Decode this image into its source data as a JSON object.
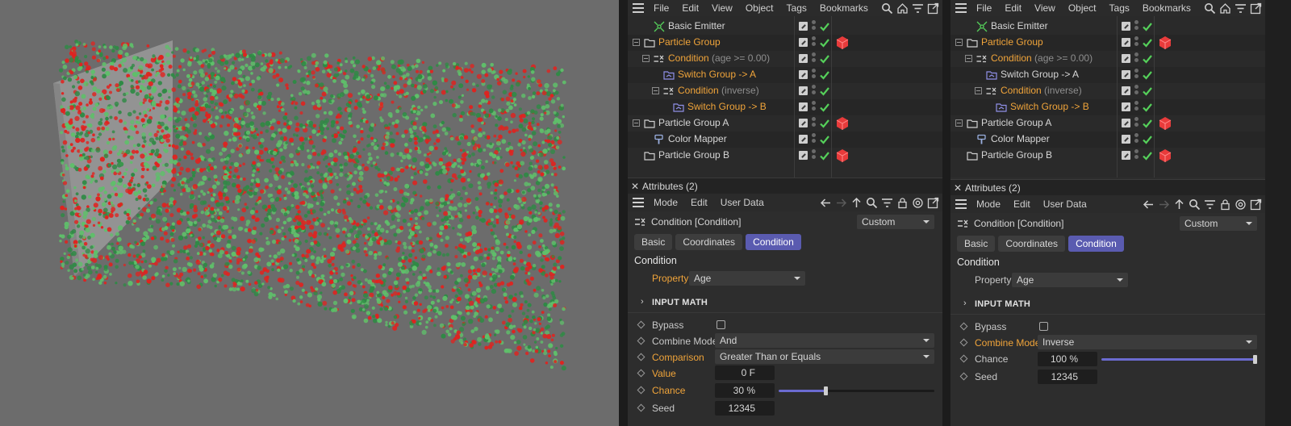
{
  "menu": {
    "items": [
      "File",
      "Edit",
      "View",
      "Object",
      "Tags",
      "Bookmarks"
    ]
  },
  "colors": {
    "accent_tab": "#5a5bb0",
    "orange": "#f0a43a",
    "check": "#55d05a",
    "cube": "#e83b3b",
    "slider": "#6b6bd0"
  },
  "viewport": {
    "particles_red": "#e0231f",
    "particles_green_light": "#5fbf6a",
    "particles_green_dark": "#2f8a45"
  },
  "panels": [
    {
      "tree": [
        {
          "label": "Basic Emitter",
          "sub": "",
          "orange": false,
          "icon": "emitter-icon",
          "tag": false
        },
        {
          "label": "Particle Group",
          "sub": "",
          "orange": true,
          "icon": "folder-icon",
          "tag": true
        },
        {
          "label": "Condition",
          "sub": "(age >= 0.00)",
          "orange": true,
          "icon": "condition-icon",
          "tag": false
        },
        {
          "label": "Switch Group -> A",
          "sub": "",
          "orange": true,
          "icon": "switch-icon",
          "tag": false
        },
        {
          "label": "Condition",
          "sub": "(inverse)",
          "orange": true,
          "icon": "condition-icon",
          "tag": false
        },
        {
          "label": "Switch Group -> B",
          "sub": "",
          "orange": true,
          "icon": "switch-icon",
          "tag": false
        },
        {
          "label": "Particle Group A",
          "sub": "",
          "orange": false,
          "icon": "folder-icon",
          "tag": true
        },
        {
          "label": "Color Mapper",
          "sub": "",
          "orange": false,
          "icon": "color-mapper-icon",
          "tag": false
        },
        {
          "label": "Particle Group B",
          "sub": "",
          "orange": false,
          "icon": "folder-icon",
          "tag": true
        }
      ],
      "attributes": {
        "header": "Attributes (2)",
        "menu": [
          "Mode",
          "Edit",
          "User Data"
        ],
        "object_name": "Condition [Condition]",
        "preset": "Custom",
        "tabs": [
          "Basic",
          "Coordinates",
          "Condition"
        ],
        "active_tab": 2,
        "section": "Condition",
        "property_label": "Property",
        "property_value": "Age",
        "input_math": "INPUT MATH",
        "bypass_label": "Bypass",
        "combine_label": "Combine Mode",
        "combine_value": "And",
        "comparison_label": "Comparison",
        "comparison_value": "Greater Than or Equals",
        "value_label": "Value",
        "value_value": "0 F",
        "chance_label": "Chance",
        "chance_value": "30 %",
        "chance_fraction": 0.3,
        "seed_label": "Seed",
        "seed_value": "12345"
      }
    },
    {
      "tree": [
        {
          "label": "Basic Emitter",
          "sub": "",
          "orange": false,
          "icon": "emitter-icon",
          "tag": false
        },
        {
          "label": "Particle Group",
          "sub": "",
          "orange": true,
          "icon": "folder-icon",
          "tag": true
        },
        {
          "label": "Condition",
          "sub": "(age >= 0.00)",
          "orange": true,
          "icon": "condition-icon",
          "tag": false
        },
        {
          "label": "Switch Group -> A",
          "sub": "",
          "orange": false,
          "icon": "switch-icon",
          "tag": false
        },
        {
          "label": "Condition",
          "sub": "(inverse)",
          "orange": true,
          "icon": "condition-icon",
          "tag": false
        },
        {
          "label": "Switch Group -> B",
          "sub": "",
          "orange": true,
          "icon": "switch-icon",
          "tag": false
        },
        {
          "label": "Particle Group A",
          "sub": "",
          "orange": false,
          "icon": "folder-icon",
          "tag": true
        },
        {
          "label": "Color Mapper",
          "sub": "",
          "orange": false,
          "icon": "color-mapper-icon",
          "tag": false
        },
        {
          "label": "Particle Group B",
          "sub": "",
          "orange": false,
          "icon": "folder-icon",
          "tag": true
        }
      ],
      "attributes": {
        "header": "Attributes (2)",
        "menu": [
          "Mode",
          "Edit",
          "User Data"
        ],
        "object_name": "Condition [Condition]",
        "preset": "Custom",
        "tabs": [
          "Basic",
          "Coordinates",
          "Condition"
        ],
        "active_tab": 2,
        "section": "Condition",
        "property_label": "Property",
        "property_value": "Age",
        "input_math": "INPUT MATH",
        "bypass_label": "Bypass",
        "combine_label": "Combine Mode",
        "combine_value": "Inverse",
        "chance_label": "Chance",
        "chance_value": "100 %",
        "chance_fraction": 1.0,
        "seed_label": "Seed",
        "seed_value": "12345"
      }
    }
  ]
}
